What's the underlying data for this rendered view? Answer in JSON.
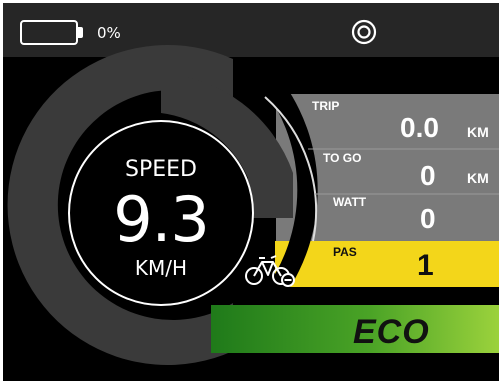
{
  "status_bar": {
    "battery_percent_text": "0%",
    "battery_level": 0,
    "status_icon": "target-circle-icon"
  },
  "speedometer": {
    "label": "SPEED",
    "value": "9.3",
    "unit": "KM/H"
  },
  "info_panel": {
    "trip": {
      "label": "TRIP",
      "value": "0.0",
      "unit": "KM"
    },
    "to_go": {
      "label": "TO GO",
      "value": "0",
      "unit": "KM"
    },
    "watt": {
      "label": "WATT",
      "value": "0"
    },
    "pas": {
      "label": "PAS",
      "value": "1"
    }
  },
  "mode": {
    "label": "ECO"
  },
  "icons": {
    "bike": "bicycle-icon"
  },
  "colors": {
    "background": "#000000",
    "top_bar": "#262626",
    "panel_gray": "#7a7a7a",
    "pas_yellow": "#f3d61a",
    "eco_green_dark": "#1f7a1a",
    "eco_green_light": "#9bd23c",
    "gauge_gray": "#3a3a3a"
  }
}
